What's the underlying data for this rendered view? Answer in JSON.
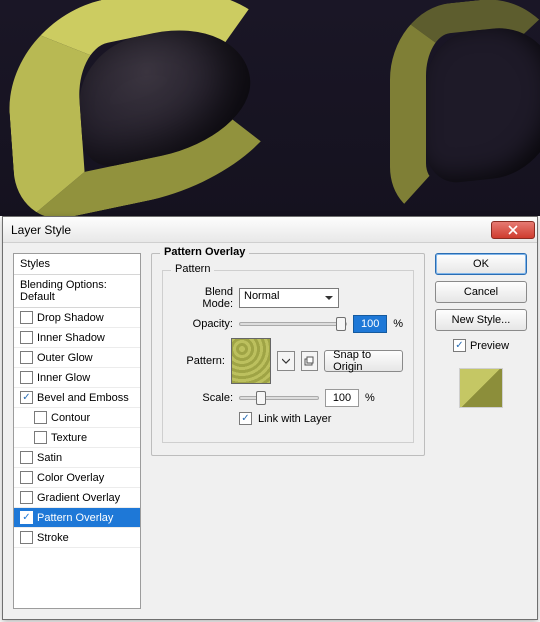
{
  "dialog_title": "Layer Style",
  "styles_panel": {
    "header": "Styles",
    "blending_label": "Blending Options: Default",
    "items": [
      {
        "label": "Drop Shadow",
        "checked": false,
        "sub": false
      },
      {
        "label": "Inner Shadow",
        "checked": false,
        "sub": false
      },
      {
        "label": "Outer Glow",
        "checked": false,
        "sub": false
      },
      {
        "label": "Inner Glow",
        "checked": false,
        "sub": false
      },
      {
        "label": "Bevel and Emboss",
        "checked": true,
        "sub": false
      },
      {
        "label": "Contour",
        "checked": false,
        "sub": true
      },
      {
        "label": "Texture",
        "checked": false,
        "sub": true
      },
      {
        "label": "Satin",
        "checked": false,
        "sub": false
      },
      {
        "label": "Color Overlay",
        "checked": false,
        "sub": false
      },
      {
        "label": "Gradient Overlay",
        "checked": false,
        "sub": false
      },
      {
        "label": "Pattern Overlay",
        "checked": true,
        "sub": false,
        "selected": true
      },
      {
        "label": "Stroke",
        "checked": false,
        "sub": false
      }
    ]
  },
  "pattern_overlay": {
    "group_title": "Pattern Overlay",
    "inner_title": "Pattern",
    "blend_mode_label": "Blend Mode:",
    "blend_mode_value": "Normal",
    "opacity_label": "Opacity:",
    "opacity_value": "100",
    "opacity_unit": "%",
    "pattern_label": "Pattern:",
    "snap_label": "Snap to Origin",
    "scale_label": "Scale:",
    "scale_value": "100",
    "scale_unit": "%",
    "link_label": "Link with Layer",
    "link_checked": true
  },
  "buttons": {
    "ok": "OK",
    "cancel": "Cancel",
    "new_style": "New Style...",
    "preview_label": "Preview",
    "preview_checked": true
  }
}
